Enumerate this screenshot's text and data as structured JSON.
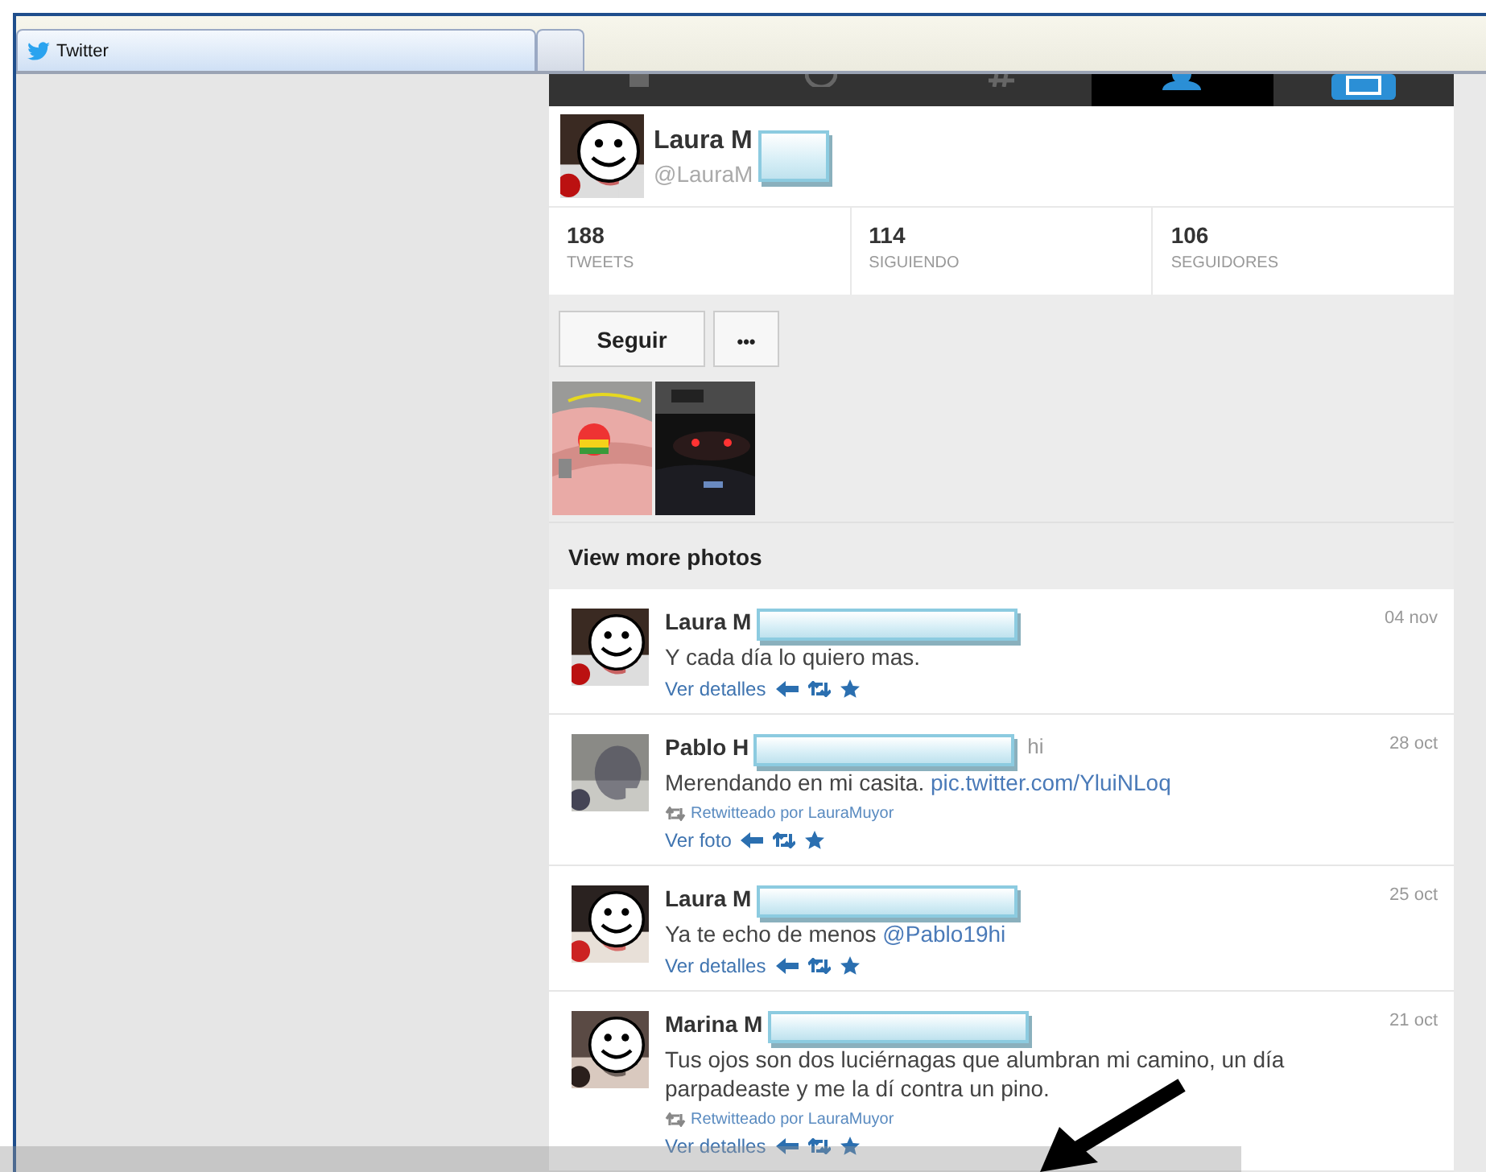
{
  "browser_tabs": [
    {
      "label": "Twitter",
      "selected": true
    },
    {
      "kind": "new",
      "selected": false
    }
  ],
  "nav": [
    {
      "kind": "home",
      "selected": false
    },
    {
      "kind": "connect",
      "selected": false
    },
    {
      "kind": "discover",
      "selected": false
    },
    {
      "kind": "me",
      "selected": true
    },
    {
      "kind": "compose",
      "selected": false
    }
  ],
  "profile": {
    "name": "Laura M",
    "handle": "@LauraM",
    "redacted": true,
    "smiley": true
  },
  "stats": [
    {
      "value": "188",
      "label": "TWEETS"
    },
    {
      "value": "114",
      "label": "SIGUIENDO"
    },
    {
      "value": "106",
      "label": "SEGUIDORES"
    }
  ],
  "buttons": [
    {
      "kind": "follow",
      "label": "Seguir"
    },
    {
      "kind": "more",
      "label": "•••"
    }
  ],
  "more_photos": "View more photos",
  "tweets": [
    {
      "name": "Laura M",
      "redacted": true,
      "time": "04 nov",
      "text": "Y cada día lo quiero mas.",
      "action": "Ver detalles",
      "smiley": true
    },
    {
      "name": "Pablo H",
      "name_tail": "hi",
      "redacted": true,
      "time": "28 oct",
      "text": "Merendando en mi casita. ",
      "link": "pic.twitter.com/YluiNLoq",
      "retweeted_by": "Retwitteado por LauraMuyor",
      "action": "Ver foto",
      "smiley": false
    },
    {
      "name": "Laura M",
      "redacted": true,
      "time": "25 oct",
      "text": "Ya te echo de menos ",
      "link": "@Pablo19hi",
      "action": "Ver detalles",
      "smiley": true
    },
    {
      "name": "Marina M",
      "redacted": true,
      "time": "21 oct",
      "text": "Tus ojos son dos luciérnagas que alumbran mi camino, un día parpadeaste y me la dí contra un pino.",
      "retweeted_by": "Retwitteado por LauraMuyor",
      "action": "Ver detalles",
      "smiley": true
    }
  ],
  "annotation": {
    "kind": "arrow"
  },
  "bottom_band": true
}
